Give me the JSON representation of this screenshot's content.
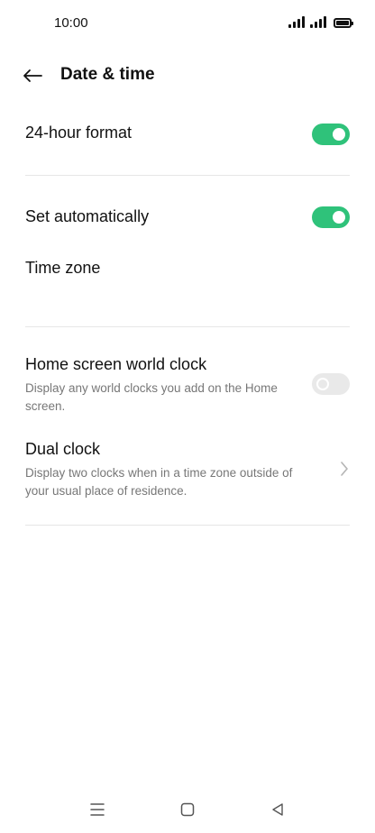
{
  "status_bar": {
    "time": "10:00",
    "icons": [
      "signal-icon",
      "signal-icon",
      "battery-icon"
    ]
  },
  "header": {
    "back_icon": "back-arrow-icon",
    "title": "Date & time"
  },
  "settings": {
    "hour_format": {
      "label": "24-hour format",
      "enabled": true
    },
    "set_automatically": {
      "label": "Set automatically",
      "enabled": true
    },
    "time_zone": {
      "label": "Time zone"
    },
    "world_clock": {
      "label": "Home screen world clock",
      "description": "Display any world clocks you add on the Home screen.",
      "enabled": false
    },
    "dual_clock": {
      "label": "Dual clock",
      "description": "Display two clocks when in a time zone outside of your usual place of residence.",
      "icon": "chevron-right-icon"
    }
  },
  "nav_bar": {
    "icons": [
      "menu-icon",
      "home-icon",
      "back-triangle-icon"
    ]
  },
  "colors": {
    "toggle_on": "#2fc27a",
    "toggle_off": "#e9e9e9"
  }
}
